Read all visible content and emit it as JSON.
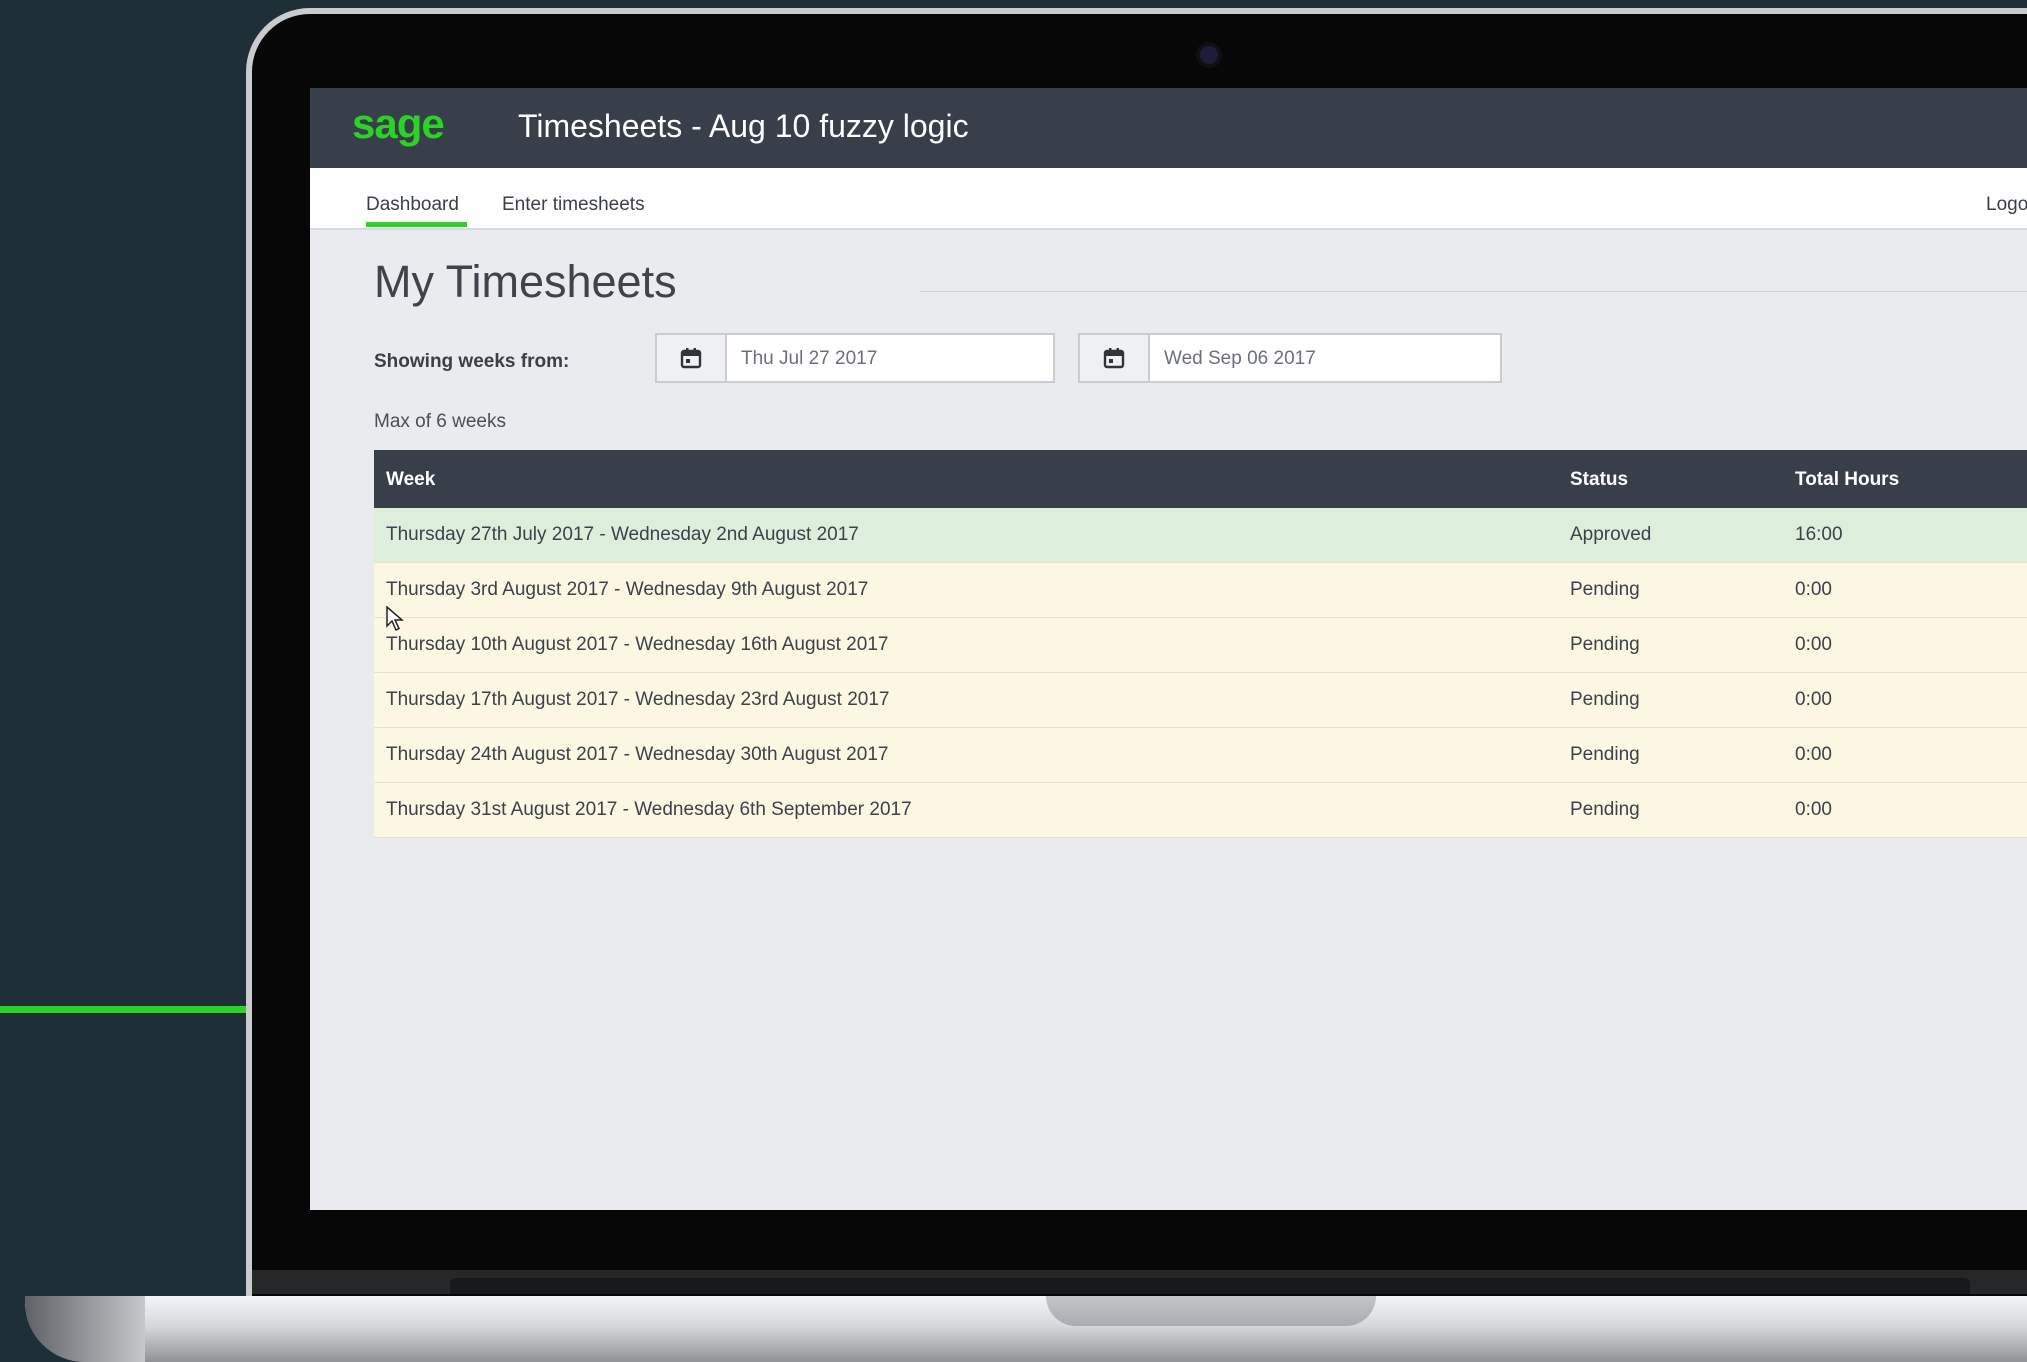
{
  "app": {
    "logo": "sage",
    "title": "Timesheets - Aug 10 fuzzy logic"
  },
  "nav": {
    "tabs": [
      "Dashboard",
      "Enter timesheets"
    ],
    "active_tab": "Dashboard",
    "logout_label": "Logo"
  },
  "page": {
    "title": "My Timesheets",
    "range_label": "Showing weeks from:",
    "from_date": "Thu Jul 27 2017",
    "to_date": "Wed Sep 06 2017",
    "max_note": "Max of 6 weeks"
  },
  "table": {
    "columns": [
      "Week",
      "Status",
      "Total Hours"
    ],
    "rows": [
      {
        "week": "Thursday 27th July 2017 - Wednesday 2nd August 2017",
        "status": "Approved",
        "hours": "16:00"
      },
      {
        "week": "Thursday 3rd August 2017 - Wednesday 9th August 2017",
        "status": "Pending",
        "hours": "0:00"
      },
      {
        "week": "Thursday 10th August 2017 - Wednesday 16th August 2017",
        "status": "Pending",
        "hours": "0:00"
      },
      {
        "week": "Thursday 17th August 2017 - Wednesday 23rd August 2017",
        "status": "Pending",
        "hours": "0:00"
      },
      {
        "week": "Thursday 24th August 2017 - Wednesday 30th August 2017",
        "status": "Pending",
        "hours": "0:00"
      },
      {
        "week": "Thursday 31st August 2017 - Wednesday 6th September 2017",
        "status": "Pending",
        "hours": "0:00"
      }
    ]
  },
  "colors": {
    "brand_green": "#2ad326",
    "header_dark": "#393f4a",
    "approved_row": "#deeedd",
    "pending_row": "#fbf7e3"
  },
  "icons": [
    "calendar-icon",
    "mouse-cursor-icon"
  ]
}
